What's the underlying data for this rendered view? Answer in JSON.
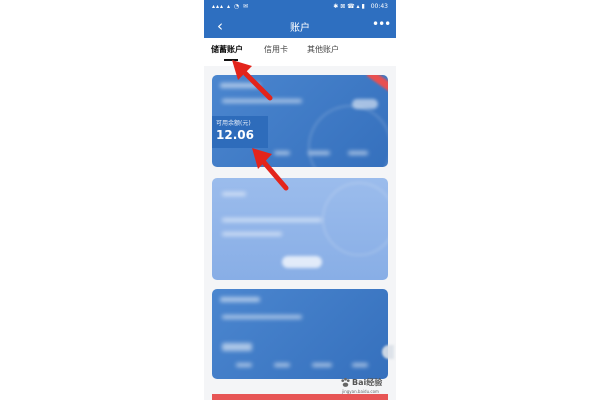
{
  "statusbar": {
    "time": "00:43",
    "left_icons": "▴▴▴ ▴ ◔ ✉",
    "right_icons": "✱ ⊠ ☎ ▴ ▮"
  },
  "appbar": {
    "back_icon": "‹",
    "title": "账户",
    "more_icon": "•••"
  },
  "tabs": [
    {
      "label": "储蓄账户",
      "active": true
    },
    {
      "label": "信用卡",
      "active": false
    },
    {
      "label": "其他账户",
      "active": false
    }
  ],
  "card_1": {
    "balance_label": "可用余额(元)",
    "balance_value": "12.06"
  },
  "watermark": {
    "text": "Bai经验",
    "url": "jingyan.baidu.com"
  },
  "colors": {
    "brand_blue": "#2e6fc0",
    "card_blue": "#4b86cf",
    "light_card": "#9bbcec",
    "arrow_red": "#e3241b",
    "accent_red": "#e75555"
  },
  "icons": [
    "chevron-left-icon",
    "more-dots-icon",
    "paw-icon",
    "arrow-icon"
  ]
}
